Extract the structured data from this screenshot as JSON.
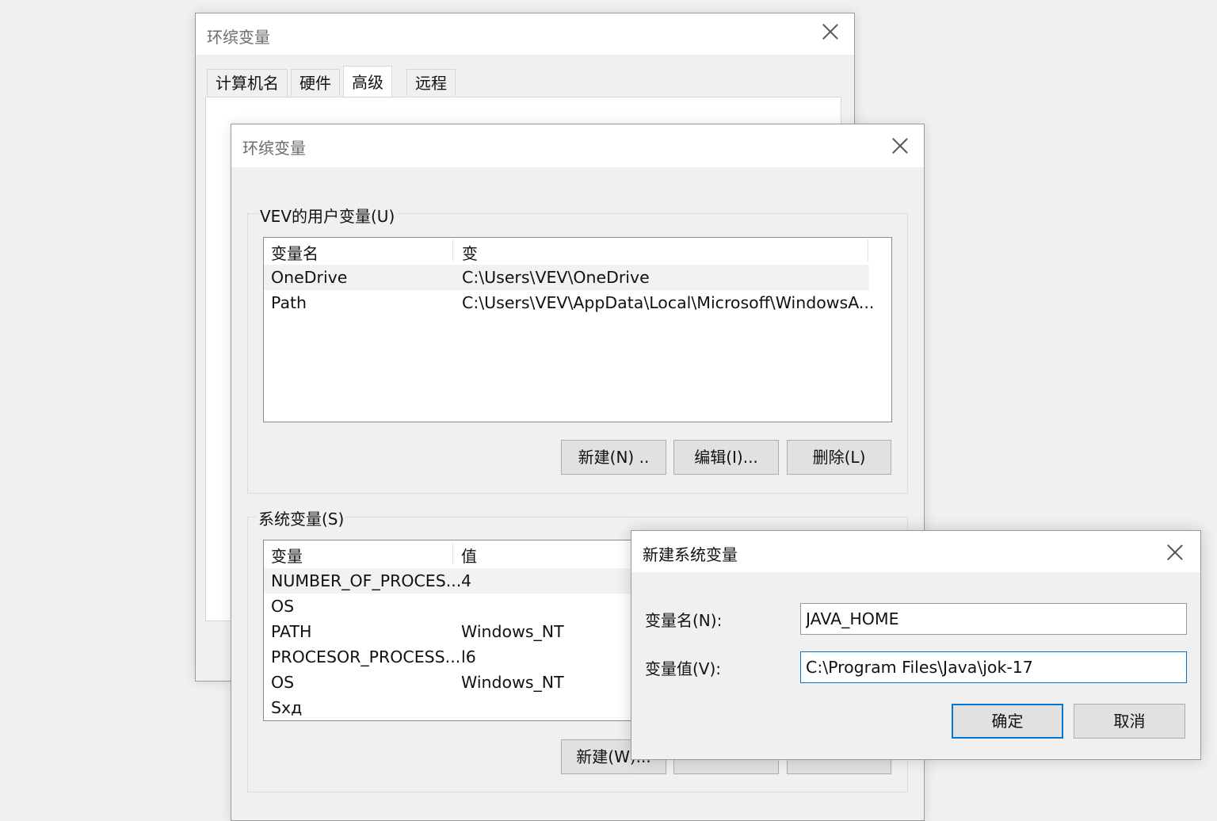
{
  "back_window": {
    "title": "环缤变量",
    "tabs": [
      {
        "label": "计算机名"
      },
      {
        "label": "硬件"
      },
      {
        "label": "高级"
      },
      {
        "label": "远程"
      }
    ]
  },
  "env_window": {
    "title": "环缤变量",
    "user_group_label": "VEV的用户变量(U)",
    "user_columns": [
      "变量名",
      "变"
    ],
    "user_rows": [
      {
        "name": "OneDrive",
        "value": "C:\\Users\\VEV\\OneDrive"
      },
      {
        "name": "Path",
        "value": "C:\\Users\\VEV\\AppData\\Local\\Microsoff\\WindowsA..."
      }
    ],
    "user_buttons": {
      "new": "新建(N) ..",
      "edit": "编辑(I)...",
      "delete": "删除(L)"
    },
    "system_group_label": "系统变量(S)",
    "system_columns": [
      "变量",
      "值"
    ],
    "system_rows": [
      {
        "name": "NUMBER_OF_PROCES...",
        "value": "4"
      },
      {
        "name": "OS",
        "value": ""
      },
      {
        "name": "PATH",
        "value": "Windows_NT"
      },
      {
        "name": "PROCESOR_PROCESS...",
        "value": "l6"
      },
      {
        "name": "OS",
        "value": "Windows_NT"
      },
      {
        "name": "Sхд",
        "value": ""
      }
    ],
    "system_buttons": {
      "new": "新建(W)..."
    }
  },
  "new_var_dialog": {
    "title": "新建系统变量",
    "name_label": "变量名(N):",
    "name_value": "JAVA_HOME",
    "value_label": "变量值(V):",
    "value_value": "C:\\Program Files\\Java\\jok-17",
    "ok": "确定",
    "cancel": "取消"
  },
  "colors": {
    "accent": "#0078d7",
    "window_bg": "#f0f0f0",
    "titlebar_bg": "#ffffff"
  }
}
